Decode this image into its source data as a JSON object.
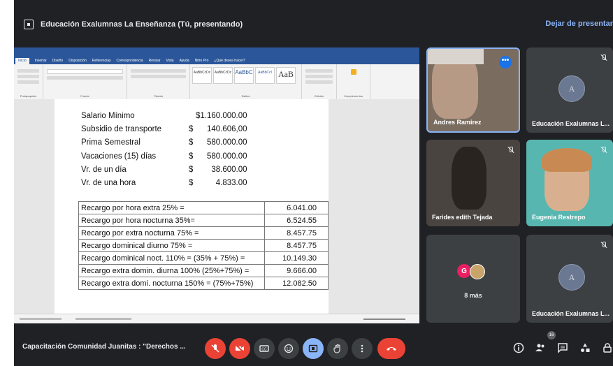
{
  "top_bar": {
    "title": "Educación Exalumnas La Enseñanza (Tú, presentando)",
    "stop_presenting": "Dejar de presentar"
  },
  "word": {
    "tabs": [
      "Inicio",
      "Insertar",
      "Diseño",
      "Disposición",
      "Referencias",
      "Correspondencia",
      "Revisar",
      "Vista",
      "Ayuda",
      "Nitro Pro",
      "¿Qué desea hacer?"
    ],
    "ribbon_groups": [
      "Portapapeles",
      "Fuente",
      "Párrafo",
      "Estilos",
      "Edición",
      "Complementos"
    ],
    "style_samples": [
      "AaBbCcDc",
      "AaBbCcDc",
      "AaBbC",
      "AaBbCcI",
      "AaB"
    ],
    "salary_rows": [
      {
        "label": "Salario Mínimo",
        "currency": "",
        "amount": "$1.160.000.00"
      },
      {
        "label": "Subsidio de transporte",
        "currency": "$",
        "amount": "140.606,00"
      },
      {
        "label": "Prima Semestral",
        "currency": "$",
        "amount": "580.000.00"
      },
      {
        "label": "Vacaciones (15) días",
        "currency": "$",
        "amount": "580.000.00"
      },
      {
        "label": "Vr. de un día",
        "currency": "$",
        "amount": "38.600.00"
      },
      {
        "label": "Vr. de una hora",
        "currency": "$",
        "amount": "4.833.00"
      }
    ],
    "surcharge_rows": [
      {
        "label": "Recargo por hora extra 25% =",
        "value": "6.041.00"
      },
      {
        "label": "Recargo por hora nocturna 35%=",
        "value": "6.524.55"
      },
      {
        "label": "Recargo por extra nocturna 75% =",
        "value": "8.457.75"
      },
      {
        "label": "Recargo dominical diurno 75%  =",
        "value": "8.457.75"
      },
      {
        "label": "Recargo dominical noct. 110% = (35% + 75%) =",
        "value": "10.149.30"
      },
      {
        "label": "Recargo extra domin. diurna 100% (25%+75%) =",
        "value": "9.666.00"
      },
      {
        "label": "Recargo extra domi. nocturna 150% = (75%+75%)",
        "value": "12.082.50"
      }
    ]
  },
  "participants": [
    {
      "name": "Andres Ramirez"
    },
    {
      "name": "Educación Exalumnas L..."
    },
    {
      "name": "Farides edith Tejada"
    },
    {
      "name": "Eugenia Restrepo"
    },
    {
      "name": "8 más",
      "avatar_letter": "G"
    },
    {
      "name": "Educación Exalumnas L..."
    }
  ],
  "bottom_bar": {
    "meeting_name": "Capacitación Comunidad Juanitas : \"Derechos ...",
    "people_count": "16"
  },
  "colors": {
    "background": "#202124",
    "tile": "#3c4043",
    "danger": "#ea4335",
    "accent": "#8ab4f8",
    "word_blue": "#2b579a"
  }
}
